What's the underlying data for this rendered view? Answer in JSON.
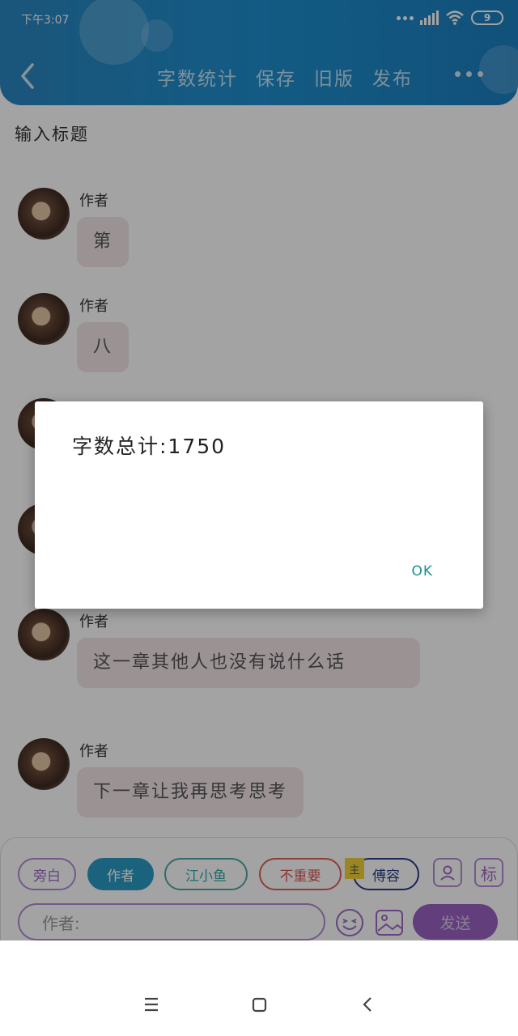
{
  "status_bar": {
    "time": "下午3:07",
    "battery": "9"
  },
  "header": {
    "nav": [
      "字数统计",
      "保存",
      "旧版",
      "发布"
    ]
  },
  "title_placeholder": "输入标题",
  "messages": [
    {
      "author": "作者",
      "text": "第"
    },
    {
      "author": "作者",
      "text": "八"
    },
    {
      "author": "作者",
      "text": "这一章其他人也没有说什么话"
    },
    {
      "author": "作者",
      "text": "下一章让我再思考思考"
    }
  ],
  "roles": {
    "narration": "旁白",
    "author": "作者",
    "jiang": "江小鱼",
    "unimportant": "不重要",
    "main_tag": "主",
    "fu": "傅容"
  },
  "icons": {
    "user": "user-icon",
    "tag_label": "标"
  },
  "input": {
    "placeholder": "作者:"
  },
  "send_label": "发送",
  "dialog": {
    "message": "字数总计:1750",
    "ok": "OK"
  }
}
